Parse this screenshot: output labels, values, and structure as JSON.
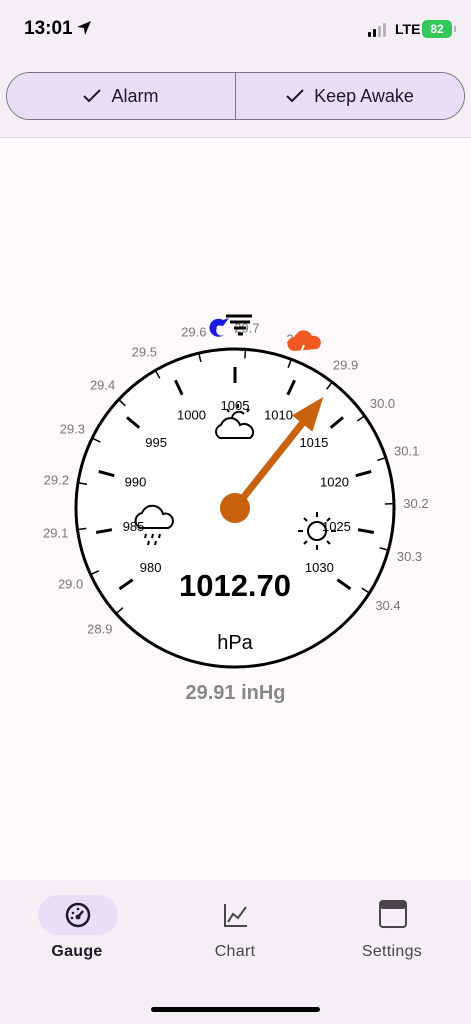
{
  "status_bar": {
    "time": "13:01",
    "network": "LTE",
    "battery": "82"
  },
  "toolbar": {
    "alarm_label": "Alarm",
    "keep_awake_label": "Keep Awake"
  },
  "gauge": {
    "value": "1012.70",
    "unit": "hPa",
    "needle_hpa": 1012.7,
    "hpa_range": [
      975,
      1035
    ],
    "hpa_labels": [
      "980",
      "985",
      "990",
      "995",
      "1000",
      "1005",
      "1010",
      "1015",
      "1020",
      "1025",
      "1030"
    ],
    "inhg_labels": [
      "28.9",
      "29.0",
      "29.1",
      "29.2",
      "29.3",
      "29.4",
      "29.5",
      "29.6",
      "29.7",
      "29.8",
      "29.9",
      "30.0",
      "30.1",
      "30.2",
      "30.3",
      "30.4"
    ],
    "needle_color": "#c8620e",
    "weather_icons": [
      "rain-cloud-icon",
      "sun-cloud-icon",
      "sun-icon",
      "hurricane-icon",
      "thunderstorm-icon"
    ]
  },
  "secondary_reading": "29.91 inHg",
  "nav": {
    "gauge_label": "Gauge",
    "chart_label": "Chart",
    "settings_label": "Settings"
  }
}
